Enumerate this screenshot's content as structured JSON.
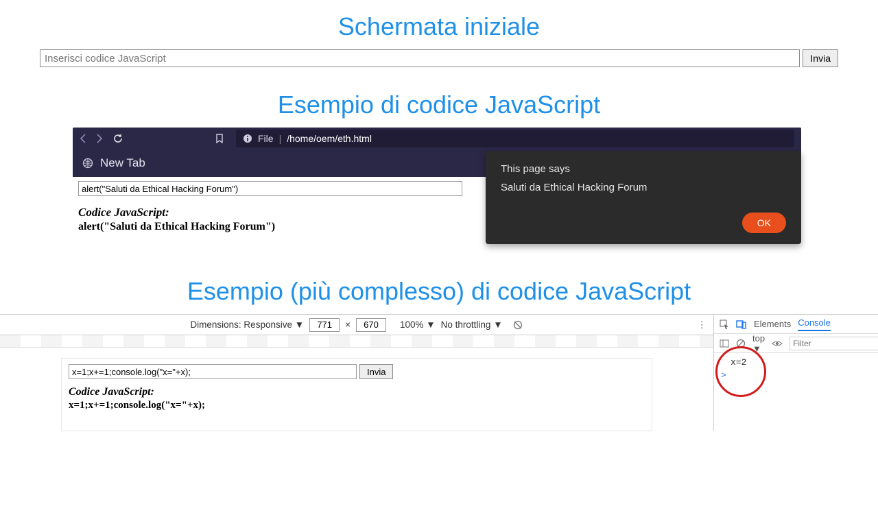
{
  "section1": {
    "heading": "Schermata iniziale",
    "input_placeholder": "Inserisci codice JavaScript",
    "submit_label": "Invia"
  },
  "section2": {
    "heading": "Esempio di codice JavaScript",
    "browser": {
      "address_scheme": "File",
      "address_path": "/home/oem/eth.html",
      "tab_label": "New Tab"
    },
    "page": {
      "input_value": "alert(\"Saluti da Ethical Hacking Forum\")",
      "code_label": "Codice JavaScript:",
      "code_line": "alert(\"Saluti da Ethical Hacking Forum\")"
    },
    "alert": {
      "title": "This page says",
      "message": "Saluti da Ethical Hacking Forum",
      "ok_label": "OK"
    }
  },
  "section3": {
    "heading": "Esempio (più complesso) di codice JavaScript",
    "devtools": {
      "dimensions_label": "Dimensions: Responsive",
      "width": "771",
      "height": "670",
      "dim_x": "×",
      "zoom": "100%",
      "throttling": "No throttling",
      "tabs": {
        "elements": "Elements",
        "console": "Console"
      },
      "context": "top",
      "filter_placeholder": "Filter",
      "console_output": "x=2",
      "console_prompt": ">"
    },
    "mini_page": {
      "input_value": "x=1;x+=1;console.log(\"x=\"+x);",
      "submit_label": "Invia",
      "code_label": "Codice JavaScript:",
      "code_line": "x=1;x+=1;console.log(\"x=\"+x);"
    }
  }
}
